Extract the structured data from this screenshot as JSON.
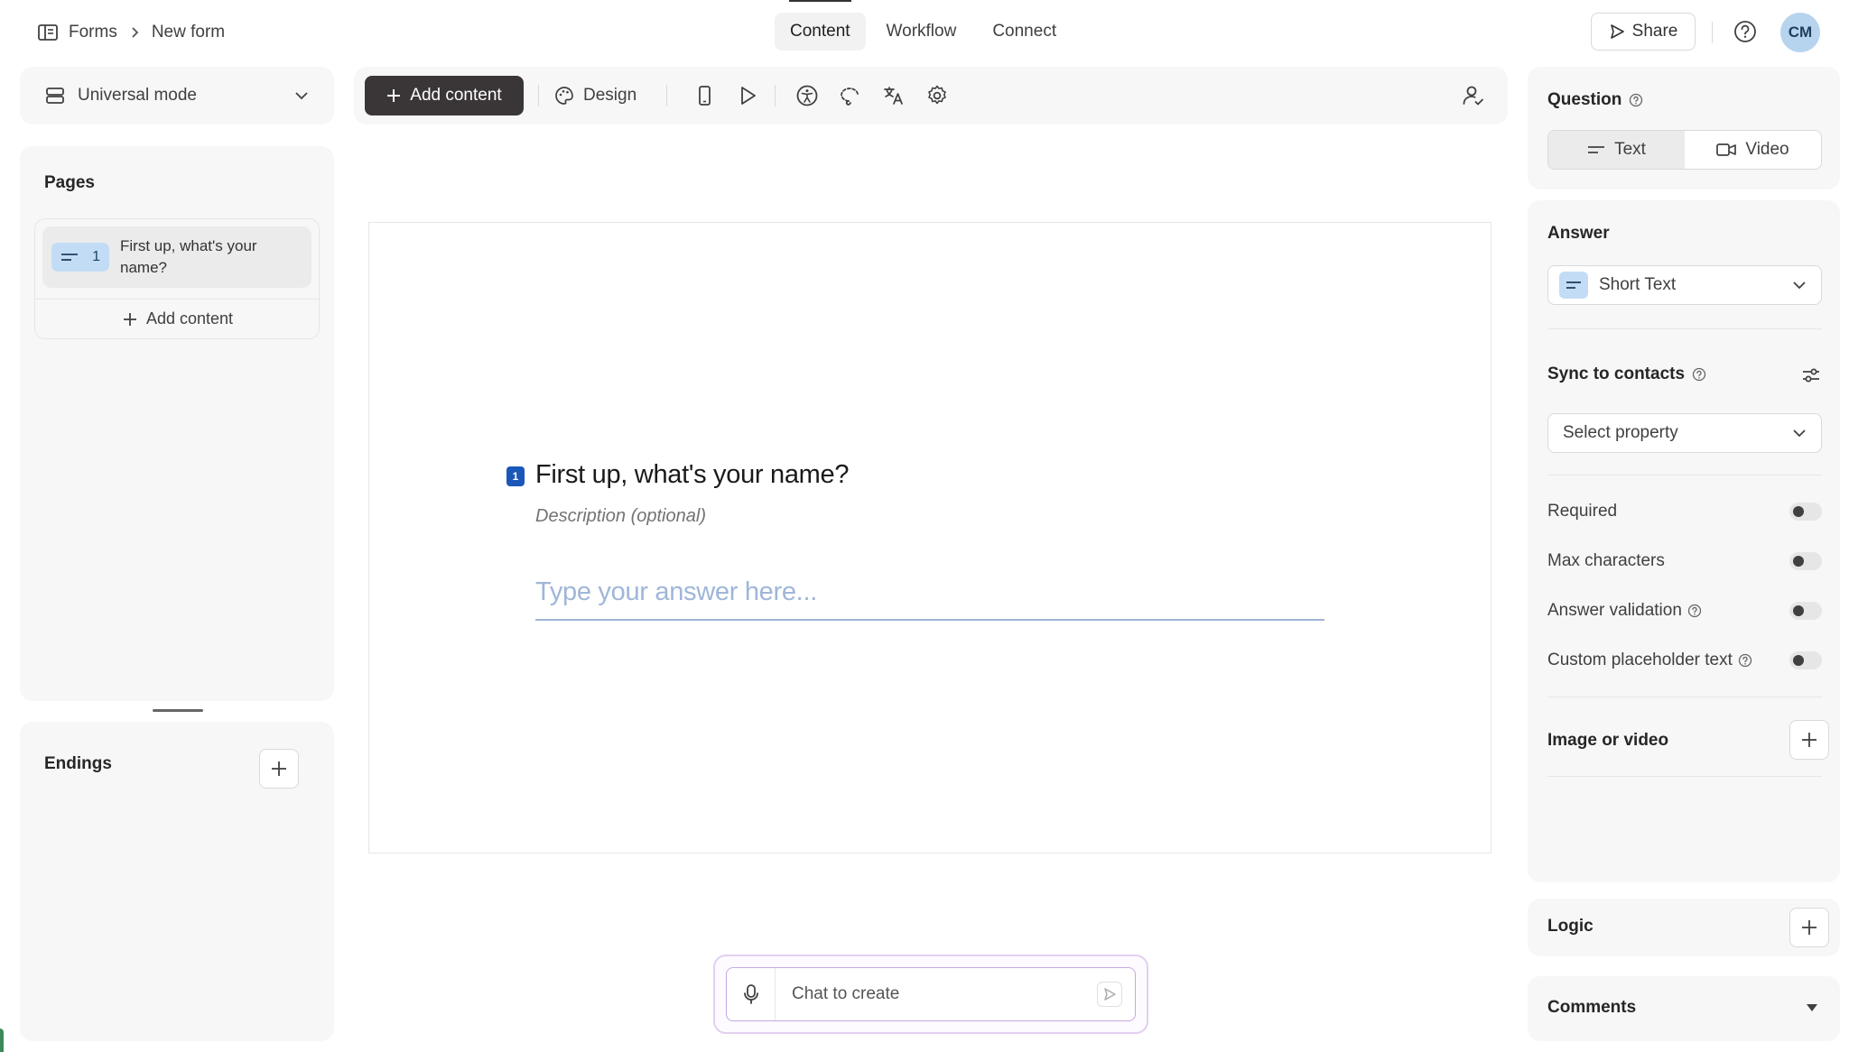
{
  "topbar": {
    "breadcrumb": {
      "root": "Forms",
      "current": "New form"
    },
    "tabs": [
      {
        "label": "Content",
        "active": true
      },
      {
        "label": "Workflow",
        "active": false
      },
      {
        "label": "Connect",
        "active": false
      }
    ],
    "share_label": "Share",
    "avatar_initials": "CM"
  },
  "left": {
    "mode_label": "Universal mode",
    "pages_title": "Pages",
    "pages": [
      {
        "number": "1",
        "label": "First up, what's your name?"
      }
    ],
    "add_content_label": "Add content",
    "endings_title": "Endings"
  },
  "toolbar": {
    "add_content_label": "Add content",
    "design_label": "Design"
  },
  "canvas": {
    "question_number": "1",
    "question_title": "First up, what's your name?",
    "description_placeholder": "Description (optional)",
    "answer_placeholder": "Type your answer here..."
  },
  "chat": {
    "placeholder": "Chat to create"
  },
  "right": {
    "question_heading": "Question",
    "question_types": [
      {
        "label": "Text",
        "selected": true
      },
      {
        "label": "Video",
        "selected": false
      }
    ],
    "answer_heading": "Answer",
    "answer_type": "Short Text",
    "sync_heading": "Sync to contacts",
    "property_placeholder": "Select property",
    "toggles": [
      {
        "label": "Required",
        "help": false,
        "on": false
      },
      {
        "label": "Max characters",
        "help": false,
        "on": false
      },
      {
        "label": "Answer validation",
        "help": true,
        "on": false
      },
      {
        "label": "Custom placeholder text",
        "help": true,
        "on": false
      }
    ],
    "image_video_heading": "Image or video",
    "logic_heading": "Logic",
    "comments_heading": "Comments"
  },
  "colors": {
    "accent_dark": "#3a3537",
    "question_badge": "#1a57b8",
    "type_badge": "#c3dcf5",
    "avatar": "#b7d4ee",
    "chat_border": "#c8a8e0"
  }
}
